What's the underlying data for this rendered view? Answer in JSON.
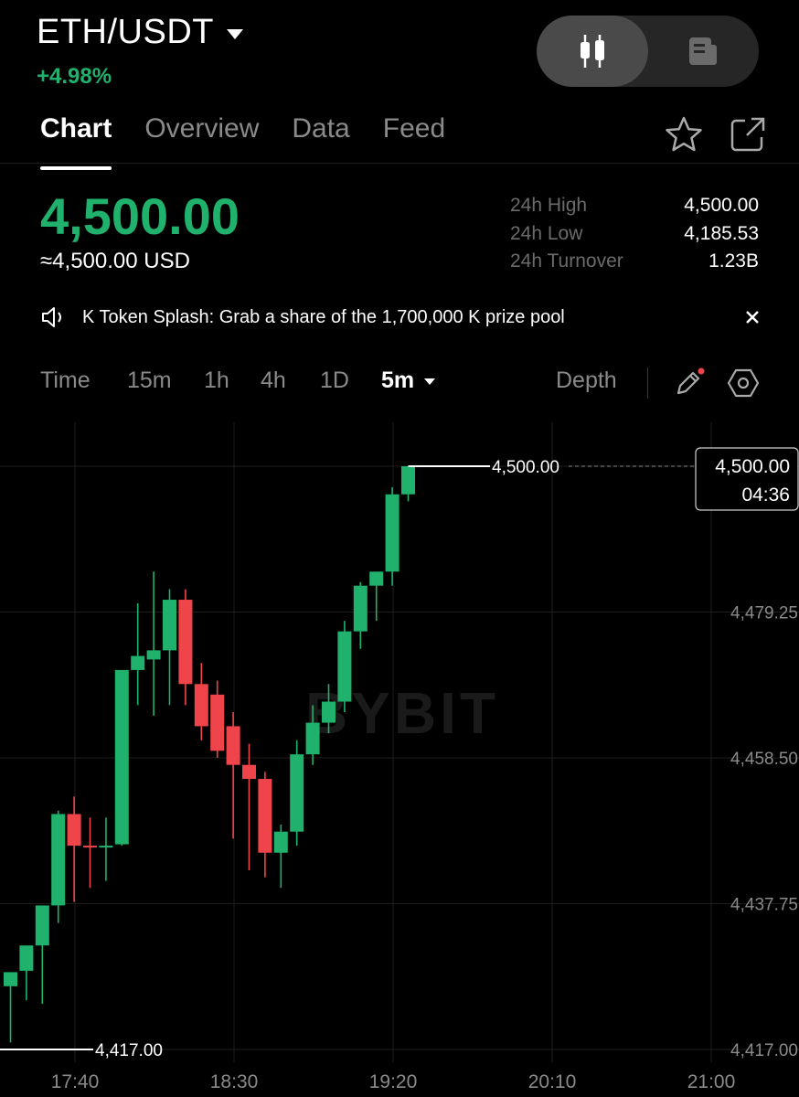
{
  "header": {
    "pair": "ETH/USDT",
    "change": "+4.98%"
  },
  "tabs": [
    "Chart",
    "Overview",
    "Data",
    "Feed"
  ],
  "active_tab": "Chart",
  "ticker": {
    "last_price": "4,500.00",
    "usd_equiv": "≈4,500.00 USD",
    "stats": [
      {
        "label": "24h High",
        "value": "4,500.00"
      },
      {
        "label": "24h Low",
        "value": "4,185.53"
      },
      {
        "label": "24h Turnover",
        "value": "1.23B"
      }
    ]
  },
  "promo": {
    "text": "K Token Splash: Grab a share of the 1,700,000 K prize pool"
  },
  "toolbar": {
    "time": "Time",
    "intervals": [
      "15m",
      "1h",
      "4h",
      "1D"
    ],
    "selected_interval": "5m",
    "depth": "Depth"
  },
  "chart_data": {
    "type": "candlestick",
    "watermark": "BYBIT",
    "x_ticks": [
      "17:40",
      "18:30",
      "19:20",
      "20:10",
      "21:00"
    ],
    "y_ticks": [
      "4,479.25",
      "4,458.50",
      "4,437.75",
      "4,417.00"
    ],
    "ylim": [
      4417.0,
      4500.0
    ],
    "high_marker": "4,500.00",
    "low_marker": "4,417.00",
    "current_price_label": "4,500.00",
    "countdown": "04:36",
    "colors": {
      "up": "#20b26c",
      "down": "#ef454a"
    },
    "candles": [
      {
        "o": 4426.0,
        "h": 4427.5,
        "l": 4418.0,
        "c": 4428.0
      },
      {
        "o": 4428.2,
        "h": 4431.5,
        "l": 4424.0,
        "c": 4431.8
      },
      {
        "o": 4431.8,
        "h": 4435.0,
        "l": 4423.5,
        "c": 4437.5
      },
      {
        "o": 4437.5,
        "h": 4451.0,
        "l": 4435.0,
        "c": 4450.5
      },
      {
        "o": 4450.5,
        "h": 4453.0,
        "l": 4438.0,
        "c": 4446.0
      },
      {
        "o": 4446.0,
        "h": 4450.0,
        "l": 4440.0,
        "c": 4445.8
      },
      {
        "o": 4445.8,
        "h": 4450.0,
        "l": 4441.0,
        "c": 4446.0
      },
      {
        "o": 4446.2,
        "h": 4470.5,
        "l": 4446.0,
        "c": 4471.0
      },
      {
        "o": 4471.0,
        "h": 4480.5,
        "l": 4466.0,
        "c": 4473.0
      },
      {
        "o": 4472.5,
        "h": 4485.0,
        "l": 4464.5,
        "c": 4473.8
      },
      {
        "o": 4473.8,
        "h": 4482.5,
        "l": 4466.0,
        "c": 4481.0
      },
      {
        "o": 4481.0,
        "h": 4482.5,
        "l": 4466.0,
        "c": 4469.0
      },
      {
        "o": 4469.0,
        "h": 4472.0,
        "l": 4461.0,
        "c": 4463.0
      },
      {
        "o": 4467.5,
        "h": 4469.5,
        "l": 4458.5,
        "c": 4459.5
      },
      {
        "o": 4463.0,
        "h": 4465.0,
        "l": 4447.0,
        "c": 4457.5
      },
      {
        "o": 4457.5,
        "h": 4460.5,
        "l": 4442.5,
        "c": 4455.5
      },
      {
        "o": 4455.5,
        "h": 4456.5,
        "l": 4441.5,
        "c": 4445.0
      },
      {
        "o": 4445.0,
        "h": 4449.0,
        "l": 4440.0,
        "c": 4448.0
      },
      {
        "o": 4448.0,
        "h": 4461.0,
        "l": 4446.0,
        "c": 4459.0
      },
      {
        "o": 4459.0,
        "h": 4466.0,
        "l": 4457.5,
        "c": 4463.5
      },
      {
        "o": 4463.5,
        "h": 4469.0,
        "l": 4462.0,
        "c": 4466.5
      },
      {
        "o": 4466.5,
        "h": 4478.0,
        "l": 4465.0,
        "c": 4476.5
      },
      {
        "o": 4476.5,
        "h": 4483.5,
        "l": 4474.0,
        "c": 4483.0
      },
      {
        "o": 4483.0,
        "h": 4484.5,
        "l": 4478.0,
        "c": 4485.0
      },
      {
        "o": 4485.0,
        "h": 4497.0,
        "l": 4483.0,
        "c": 4496.0
      },
      {
        "o": 4496.0,
        "h": 4500.0,
        "l": 4495.0,
        "c": 4500.0
      }
    ]
  }
}
